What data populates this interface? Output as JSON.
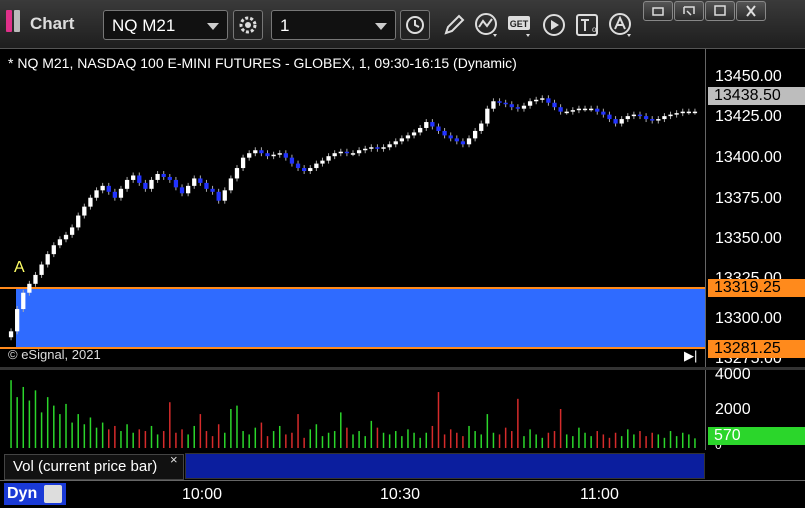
{
  "app": {
    "title": "Chart"
  },
  "toolbar": {
    "symbol_value": "NQ M21",
    "interval_value": "1",
    "icons": [
      "settings-icon",
      "clock-icon",
      "pencil-icon",
      "studies-icon",
      "get-icon",
      "play-icon",
      "text-icon",
      "alert-icon"
    ]
  },
  "window_controls": [
    "restore",
    "minimize",
    "maximize",
    "close"
  ],
  "chart": {
    "description": "* NQ M21, NASDAQ 100 E-MINI FUTURES - GLOBEX, 1, 09:30-16:15 (Dynamic)",
    "copyright": "© eSignal, 2021",
    "marker_label": "A",
    "up_color": "#ffffff",
    "down_color": "#2233ff",
    "band_color": "#2f6bff",
    "line_color": "#ff8a1c"
  },
  "price_axis": {
    "ticks": [
      "13450.00",
      "13425.00",
      "13400.00",
      "13375.00",
      "13350.00",
      "13325.00",
      "13300.00",
      "13275.00"
    ],
    "last_price": "13438.50",
    "upper_line": "13319.25",
    "lower_line": "13281.25"
  },
  "volume": {
    "legend": "Vol (current price bar)",
    "close_label": "×",
    "ticks": [
      "4000",
      "2000",
      "0"
    ],
    "last_value": "570",
    "up_color": "#2bd62b",
    "down_color": "#d62b2b"
  },
  "time_axis": {
    "labels": [
      "10:00",
      "10:30",
      "11:00"
    ],
    "mode_label": "Dyn"
  },
  "chart_data": {
    "type": "candlestick",
    "ylim": [
      13270,
      13460
    ],
    "closes": [
      13290,
      13305,
      13316,
      13322,
      13328,
      13335,
      13342,
      13348,
      13352,
      13355,
      13360,
      13368,
      13374,
      13380,
      13385,
      13388,
      13384,
      13380,
      13386,
      13392,
      13395,
      13390,
      13386,
      13392,
      13396,
      13394,
      13392,
      13387,
      13383,
      13388,
      13393,
      13390,
      13386,
      13384,
      13378,
      13385,
      13393,
      13400,
      13407,
      13410,
      13412,
      13410,
      13408,
      13409,
      13410,
      13407,
      13403,
      13400,
      13398,
      13400,
      13403,
      13405,
      13408,
      13410,
      13411,
      13410,
      13410,
      13412,
      13413,
      13414,
      13413,
      13414,
      13416,
      13418,
      13420,
      13422,
      13424,
      13427,
      13431,
      13428,
      13425,
      13422,
      13420,
      13418,
      13416,
      13420,
      13425,
      13430,
      13440,
      13445,
      13444,
      13443,
      13441,
      13440,
      13442,
      13445,
      13446,
      13447,
      13444,
      13441,
      13438,
      13438,
      13439,
      13440,
      13440,
      13440,
      13438,
      13436,
      13433,
      13430,
      13433,
      13435,
      13436,
      13435,
      13433,
      13432,
      13433,
      13435,
      13436,
      13437,
      13438,
      13438,
      13438
    ],
    "volumes": [
      4000,
      3000,
      3600,
      2800,
      3400,
      2100,
      3000,
      2500,
      2000,
      2600,
      1500,
      2000,
      1400,
      1800,
      1200,
      1500,
      1100,
      1300,
      1000,
      1400,
      900,
      1100,
      1000,
      1300,
      800,
      1000,
      2700,
      900,
      1100,
      800,
      1300,
      2000,
      1000,
      700,
      1400,
      900,
      2300,
      2500,
      1000,
      800,
      1200,
      1500,
      700,
      1000,
      1300,
      800,
      900,
      2000,
      600,
      1100,
      1400,
      700,
      900,
      1000,
      2100,
      1200,
      800,
      1000,
      700,
      1600,
      1200,
      900,
      800,
      1000,
      700,
      1100,
      900,
      600,
      900,
      1300,
      3300,
      800,
      1100,
      900,
      700,
      1300,
      1000,
      800,
      2000,
      900,
      800,
      1200,
      1000,
      2900,
      700,
      1100,
      800,
      600,
      900,
      1000,
      2300,
      800,
      700,
      1200,
      900,
      700,
      1000,
      800,
      600,
      900,
      700,
      1100,
      800,
      1000,
      700,
      900,
      800,
      600,
      1000,
      700,
      900,
      800,
      570
    ]
  }
}
